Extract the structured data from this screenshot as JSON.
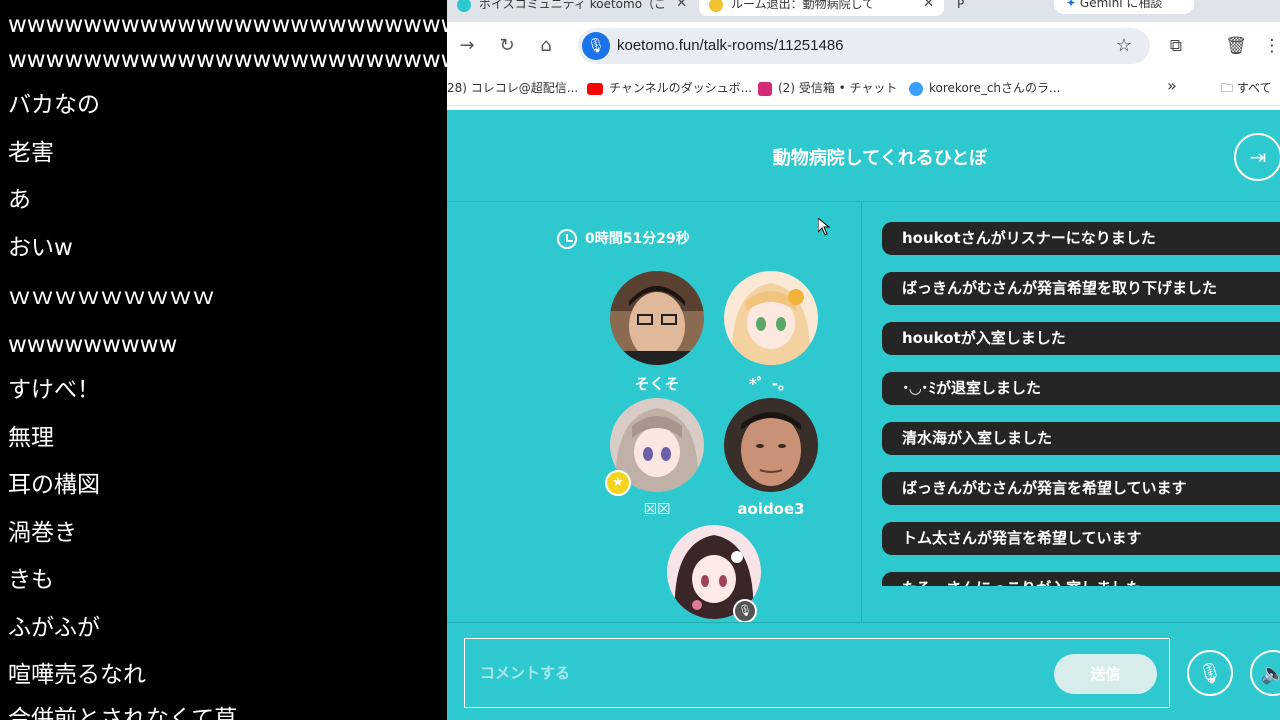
{
  "comments": [
    "wwwwwwwwwwwwwwwwwwwwwwwwww",
    "wwwwwwwwwwwwwwwwwwwwwwwwww",
    "バカなの",
    "老害",
    "あ",
    "おいw",
    "ｗｗｗｗｗｗｗｗｗ",
    "wwwwwwwww",
    "すけべ！",
    "無理",
    "耳の構図",
    "渦巻き",
    "きも",
    "ふがふが",
    "喧嘩売るなれ",
    "合併前とされなくて草"
  ],
  "browser": {
    "tabs": [
      {
        "label": "ボイスコミュニティ koetomo（こ",
        "fav_color": "#2ec8cf"
      },
      {
        "label": "ルーム退出：動物病院して",
        "fav_color": "#f2c230"
      },
      {
        "label": "P",
        "fav_color": "#888888"
      }
    ],
    "gemini_label": "Gemini に相談",
    "url": "koetomo.fun/talk-rooms/11251486",
    "bookmarks": [
      {
        "label": "28) コレコレ@超配信...",
        "color": "#5b8def"
      },
      {
        "label": "チャンネルのダッシュボ...",
        "color": "#ff0000"
      },
      {
        "label": "(2) 受信箱 • チャット",
        "color": "#d62976"
      },
      {
        "label": "korekore_chさんのラ...",
        "color": "#3aa0ff"
      }
    ],
    "more_bookmarks": "»",
    "all_bookmarks": "すべて"
  },
  "room": {
    "title": "動物病院してくれるひとぼ",
    "timer": "0時間51分29秒",
    "participants": [
      {
        "name": "そくそ"
      },
      {
        "name": "*゜-。"
      },
      {
        "name": "☒☒"
      },
      {
        "name": "aoidoe3"
      },
      {
        "name": ""
      }
    ],
    "log": [
      "houkotさんがリスナーになりました",
      "ばっきんがむさんが発言希望を取り下げました",
      "houkotが入室しました",
      "･◡･ﾐが退室しました",
      "清水海が入室しました",
      "ばっきんがむさんが発言を希望しています",
      "トム太さんが発言を希望しています",
      "たろーさんにっこりが入室しました"
    ],
    "comment_placeholder": "コメントする",
    "send_label": "送信"
  },
  "icons": {
    "back": "arrow-right-icon",
    "reload": "reload-icon",
    "home": "home-icon",
    "mic": "microphone-icon",
    "star": "star-icon",
    "extensions": "puzzle-icon",
    "delete": "trash-icon",
    "exit": "exit-icon",
    "clock": "clock-icon",
    "speaker": "speaker-icon"
  },
  "colors": {
    "page_bg": "#2ec8cf",
    "log_bubble": "#252525",
    "host_badge": "#f5d31a"
  }
}
